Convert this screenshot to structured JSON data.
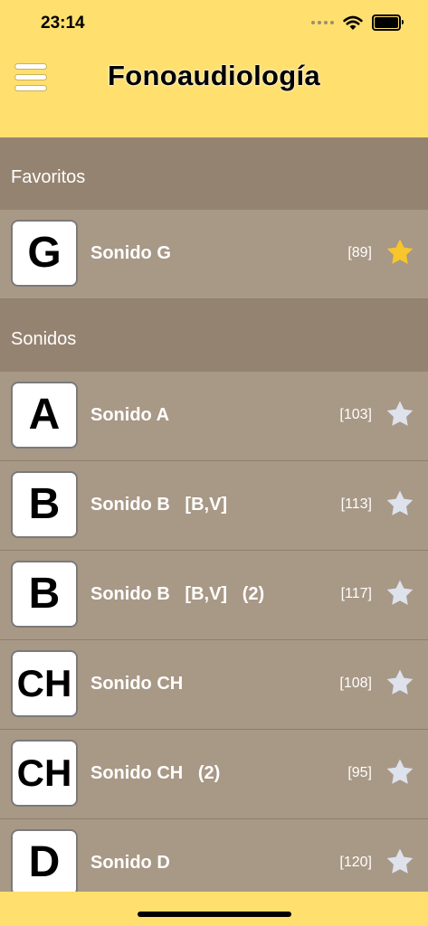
{
  "status_bar": {
    "time": "23:14"
  },
  "header": {
    "title": "Fonoaudiología"
  },
  "sections": [
    {
      "label": "Favoritos"
    },
    {
      "label": "Sonidos"
    }
  ],
  "favorites": [
    {
      "letter": "G",
      "label": "Sonido G",
      "count": "[89]",
      "favorite": true
    }
  ],
  "sounds": [
    {
      "letter": "A",
      "label": "Sonido A",
      "count": "[103]",
      "favorite": false
    },
    {
      "letter": "B",
      "label": "Sonido B   [B,V]",
      "count": "[113]",
      "favorite": false
    },
    {
      "letter": "B",
      "label": "Sonido B   [B,V]   (2)",
      "count": "[117]",
      "favorite": false
    },
    {
      "letter": "CH",
      "label": "Sonido CH",
      "count": "[108]",
      "favorite": false
    },
    {
      "letter": "CH",
      "label": "Sonido CH   (2)",
      "count": "[95]",
      "favorite": false
    },
    {
      "letter": "D",
      "label": "Sonido D",
      "count": "[120]",
      "favorite": false
    }
  ],
  "colors": {
    "header": "#ffdf6e",
    "section": "#958371",
    "row": "#a89886",
    "star_active": "#f7c52c",
    "star_inactive": "#dde2ec"
  },
  "icons": {
    "menu": "hamburger-menu-icon",
    "favorite_on": "star-filled-icon",
    "favorite_off": "star-outline-icon"
  }
}
